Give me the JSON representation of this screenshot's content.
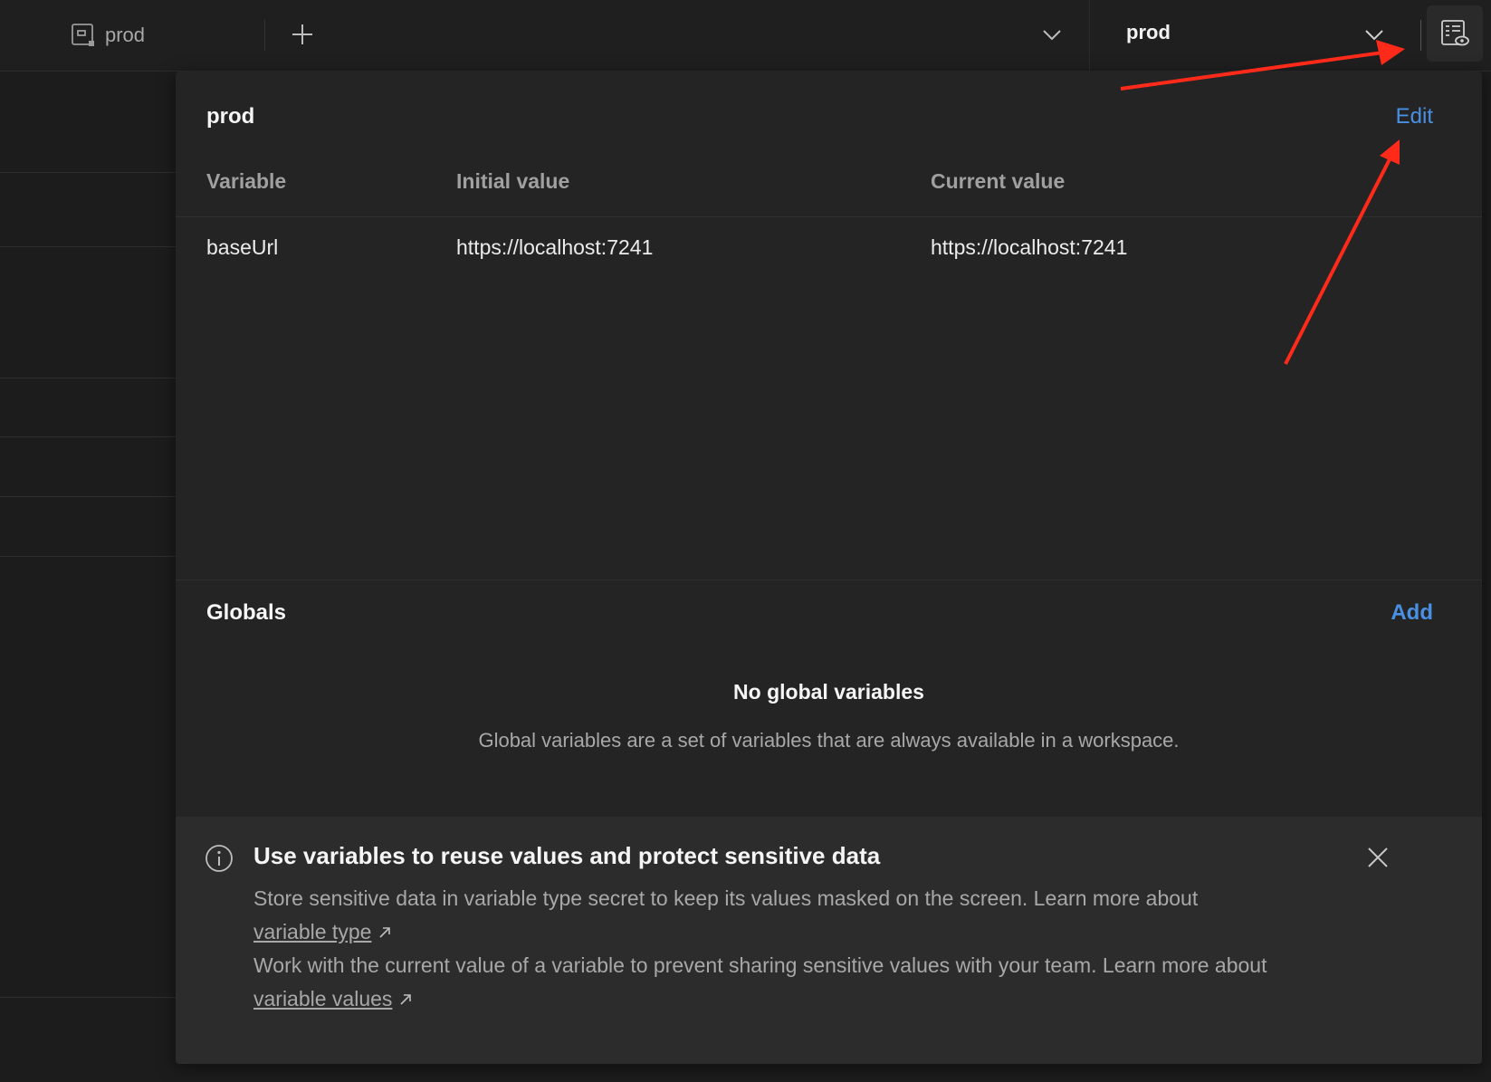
{
  "topbar": {
    "tab_label": "prod",
    "environment_selected": "prod"
  },
  "panel": {
    "environment_name": "prod",
    "edit_label": "Edit",
    "columns": [
      "Variable",
      "Initial value",
      "Current value"
    ],
    "rows": [
      {
        "variable": "baseUrl",
        "initial_value": "https://localhost:7241",
        "current_value": "https://localhost:7241"
      }
    ],
    "globals": {
      "title": "Globals",
      "add_label": "Add",
      "empty_title": "No global variables",
      "empty_description": "Global variables are a set of variables that are always available in a workspace."
    },
    "banner": {
      "title": "Use variables to reuse values and protect sensitive data",
      "line1_text": "Store sensitive data in variable type secret to keep its values masked on the screen. Learn more about",
      "line1_link": "variable type",
      "line2_text": "Work with the current value of a variable to prevent sharing sensitive values with your team. Learn more about",
      "line2_link": "variable values"
    }
  },
  "colors": {
    "background": "#1c1c1c",
    "panel": "#242424",
    "banner": "#2c2c2c",
    "link_accent": "#4a90e2",
    "annotation_arrow": "#ff2a1a"
  },
  "icons": [
    "environment-tab-icon",
    "plus-icon",
    "chevron-down-icon",
    "environment-quick-look-icon",
    "info-icon",
    "close-icon",
    "external-link-icon"
  ]
}
